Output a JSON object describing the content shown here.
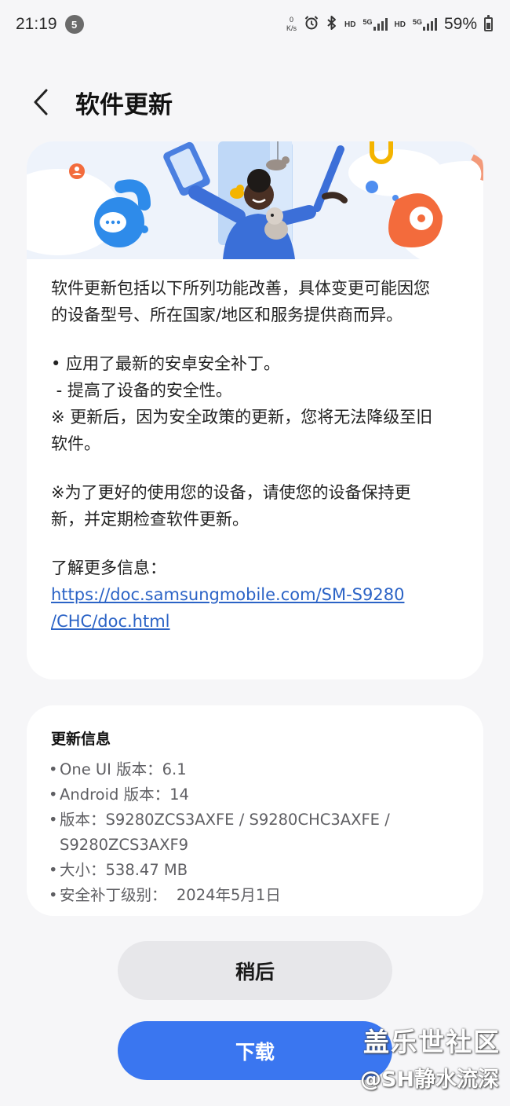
{
  "status_bar": {
    "time": "21:19",
    "notification_count": "5",
    "net_speed_value": "0",
    "net_speed_unit": "K/s",
    "hd1": "HD",
    "net1": "5G",
    "hd2": "HD",
    "net2": "5G",
    "battery": "59%",
    "icons": [
      "alarm-icon",
      "bluetooth-icon",
      "signal-icon",
      "battery-icon"
    ]
  },
  "header": {
    "back_icon": "chevron-left-icon",
    "title": "软件更新"
  },
  "release_notes": {
    "intro_line1": "软件更新包括以下所列功能改善，具体变更可能因您",
    "intro_line2": "的设备型号、所在国家/地区和服务提供商而异。",
    "bullet1": "• 应用了最新的安卓安全补丁。",
    "bullet1_sub": " - 提高了设备的安全性。",
    "note1_line1": "※ 更新后，因为安全政策的更新，您将无法降级至旧",
    "note1_line2": "软件。",
    "note2_line1": "※为了更好的使用您的设备，请使您的设备保持更",
    "note2_line2": "新，并定期检查软件更新。",
    "more_info_label": "了解更多信息：",
    "link_line1": "https://doc.samsungmobile.com/SM-S9280",
    "link_line2": "/CHC/doc.html"
  },
  "update_info": {
    "title": "更新信息",
    "oneui": "One UI 版本：6.1",
    "android": "Android 版本：14",
    "version_line1": "版本：S9280ZCS3AXFE / S9280CHC3AXFE /",
    "version_line2": "S9280ZCS3AXF9",
    "size": "大小：538.47 MB",
    "patch": "安全补丁级别：  2024年5月1日",
    "bullet": "•"
  },
  "buttons": {
    "later": "稍后",
    "download": "下载"
  },
  "watermark": {
    "line1": "盖乐世社区",
    "line2": "@SH静水流深"
  },
  "colors": {
    "accent": "#3a76f0",
    "link": "#2b63c6",
    "background": "#f6f6f8"
  }
}
